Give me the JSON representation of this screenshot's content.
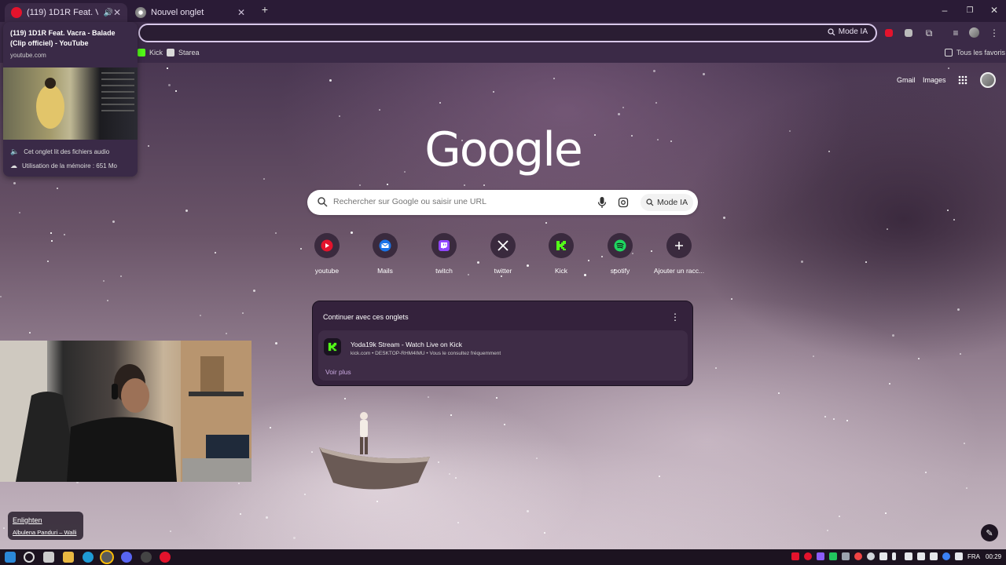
{
  "tabs": [
    {
      "title": "(119) 1D1R Feat. Vacra - Bal",
      "active": true,
      "favicon": "youtube-icon"
    },
    {
      "title": "Nouvel onglet",
      "active": false,
      "favicon": "chrome-icon"
    }
  ],
  "omnibox": {
    "mode_label": "Mode IA"
  },
  "bookmarks": {
    "items": [
      {
        "label": "Kick"
      },
      {
        "label": "Starea"
      }
    ],
    "all_label": "Tous les favoris"
  },
  "hover_card": {
    "title": "(119) 1D1R Feat. Vacra - Balade (Clip officiel) - YouTube",
    "domain": "youtube.com",
    "audio_text": "Cet onglet lit des fichiers audio",
    "memory_text": "Utilisation de la mémoire : 651 Mo"
  },
  "ntp": {
    "gmail": "Gmail",
    "images": "Images",
    "logo": "Google",
    "search_placeholder": "Rechercher sur Google ou saisir une URL",
    "mode_ia": "Mode IA",
    "shortcuts": [
      {
        "label": "youtube",
        "icon": "youtube-icon",
        "color": "#e3132c"
      },
      {
        "label": "Mails",
        "icon": "mail-icon",
        "color": "#1a73e8"
      },
      {
        "label": "twitch",
        "icon": "twitch-icon",
        "color": "#9146ff"
      },
      {
        "label": "twitter",
        "icon": "x-icon",
        "color": "#ffffff"
      },
      {
        "label": "Kick",
        "icon": "kick-icon",
        "color": "#53fc18"
      },
      {
        "label": "spotify",
        "icon": "spotify-icon",
        "color": "#1ed760"
      },
      {
        "label": "Ajouter un racc...",
        "icon": "plus-icon",
        "color": "#ffffff"
      }
    ],
    "continue": {
      "title": "Continuer avec ces onglets",
      "item_title": "Yoda19k Stream - Watch Live on Kick",
      "item_sub": "kick.com • DESKTOP-RHM4IMU • Vous le consultez fréquemment",
      "more": "Voir plus"
    }
  },
  "media": {
    "song": "Enlighten",
    "artist": "Albulena Panduri – Walli"
  },
  "taskbar": {
    "lang": "FRA",
    "time": "00:29"
  }
}
